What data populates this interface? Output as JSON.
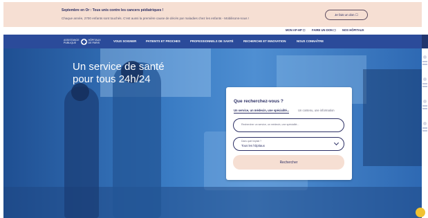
{
  "banner": {
    "title": "Septembre en Or : Tous unis contre les cancers pédiatriques !",
    "text": "Chaque année, 2700 enfants sont touchés. C'est aussi la première cause de décès par maladies chez les enfants - Mobilisons-nous !",
    "donate_label": "Je fais un don ☐"
  },
  "utility_nav": {
    "items": [
      "MON AP-HP ☐",
      "FAIRE UN DON ☐",
      "NOS HÔPITAUX"
    ]
  },
  "logo": {
    "left_text": "ASSISTANCE\nPUBLIQUE",
    "right_text": "HÔPITAUX\nDE PARIS"
  },
  "main_nav": {
    "items": [
      "VOUS SOIGNER",
      "PATIENTS ET PROCHES",
      "PROFESSIONNELS DE SANTÉ",
      "RECHERCHE ET INNOVATION",
      "NOUS CONNAÎTRE"
    ]
  },
  "hero": {
    "title_line1": "Un service de santé",
    "title_line2": "pour tous 24h/24"
  },
  "search": {
    "title": "Que recherchez-vous ?",
    "tab_active": "Un service, un médecin, une spécialité...",
    "tab_inactive": "Un contenu, une information",
    "input_placeholder": "Rechercher un service, un médecin, une spécialité...",
    "select_label": "Dans quel hôpital ?",
    "select_value": "Tous les hôpitaux",
    "submit_label": "Rechercher"
  },
  "colors": {
    "brand_navy": "#2b2e64",
    "nav_blue": "#2b4b9a",
    "banner_peach": "#f6dfd3",
    "hero_blue": "#2e69b3"
  }
}
